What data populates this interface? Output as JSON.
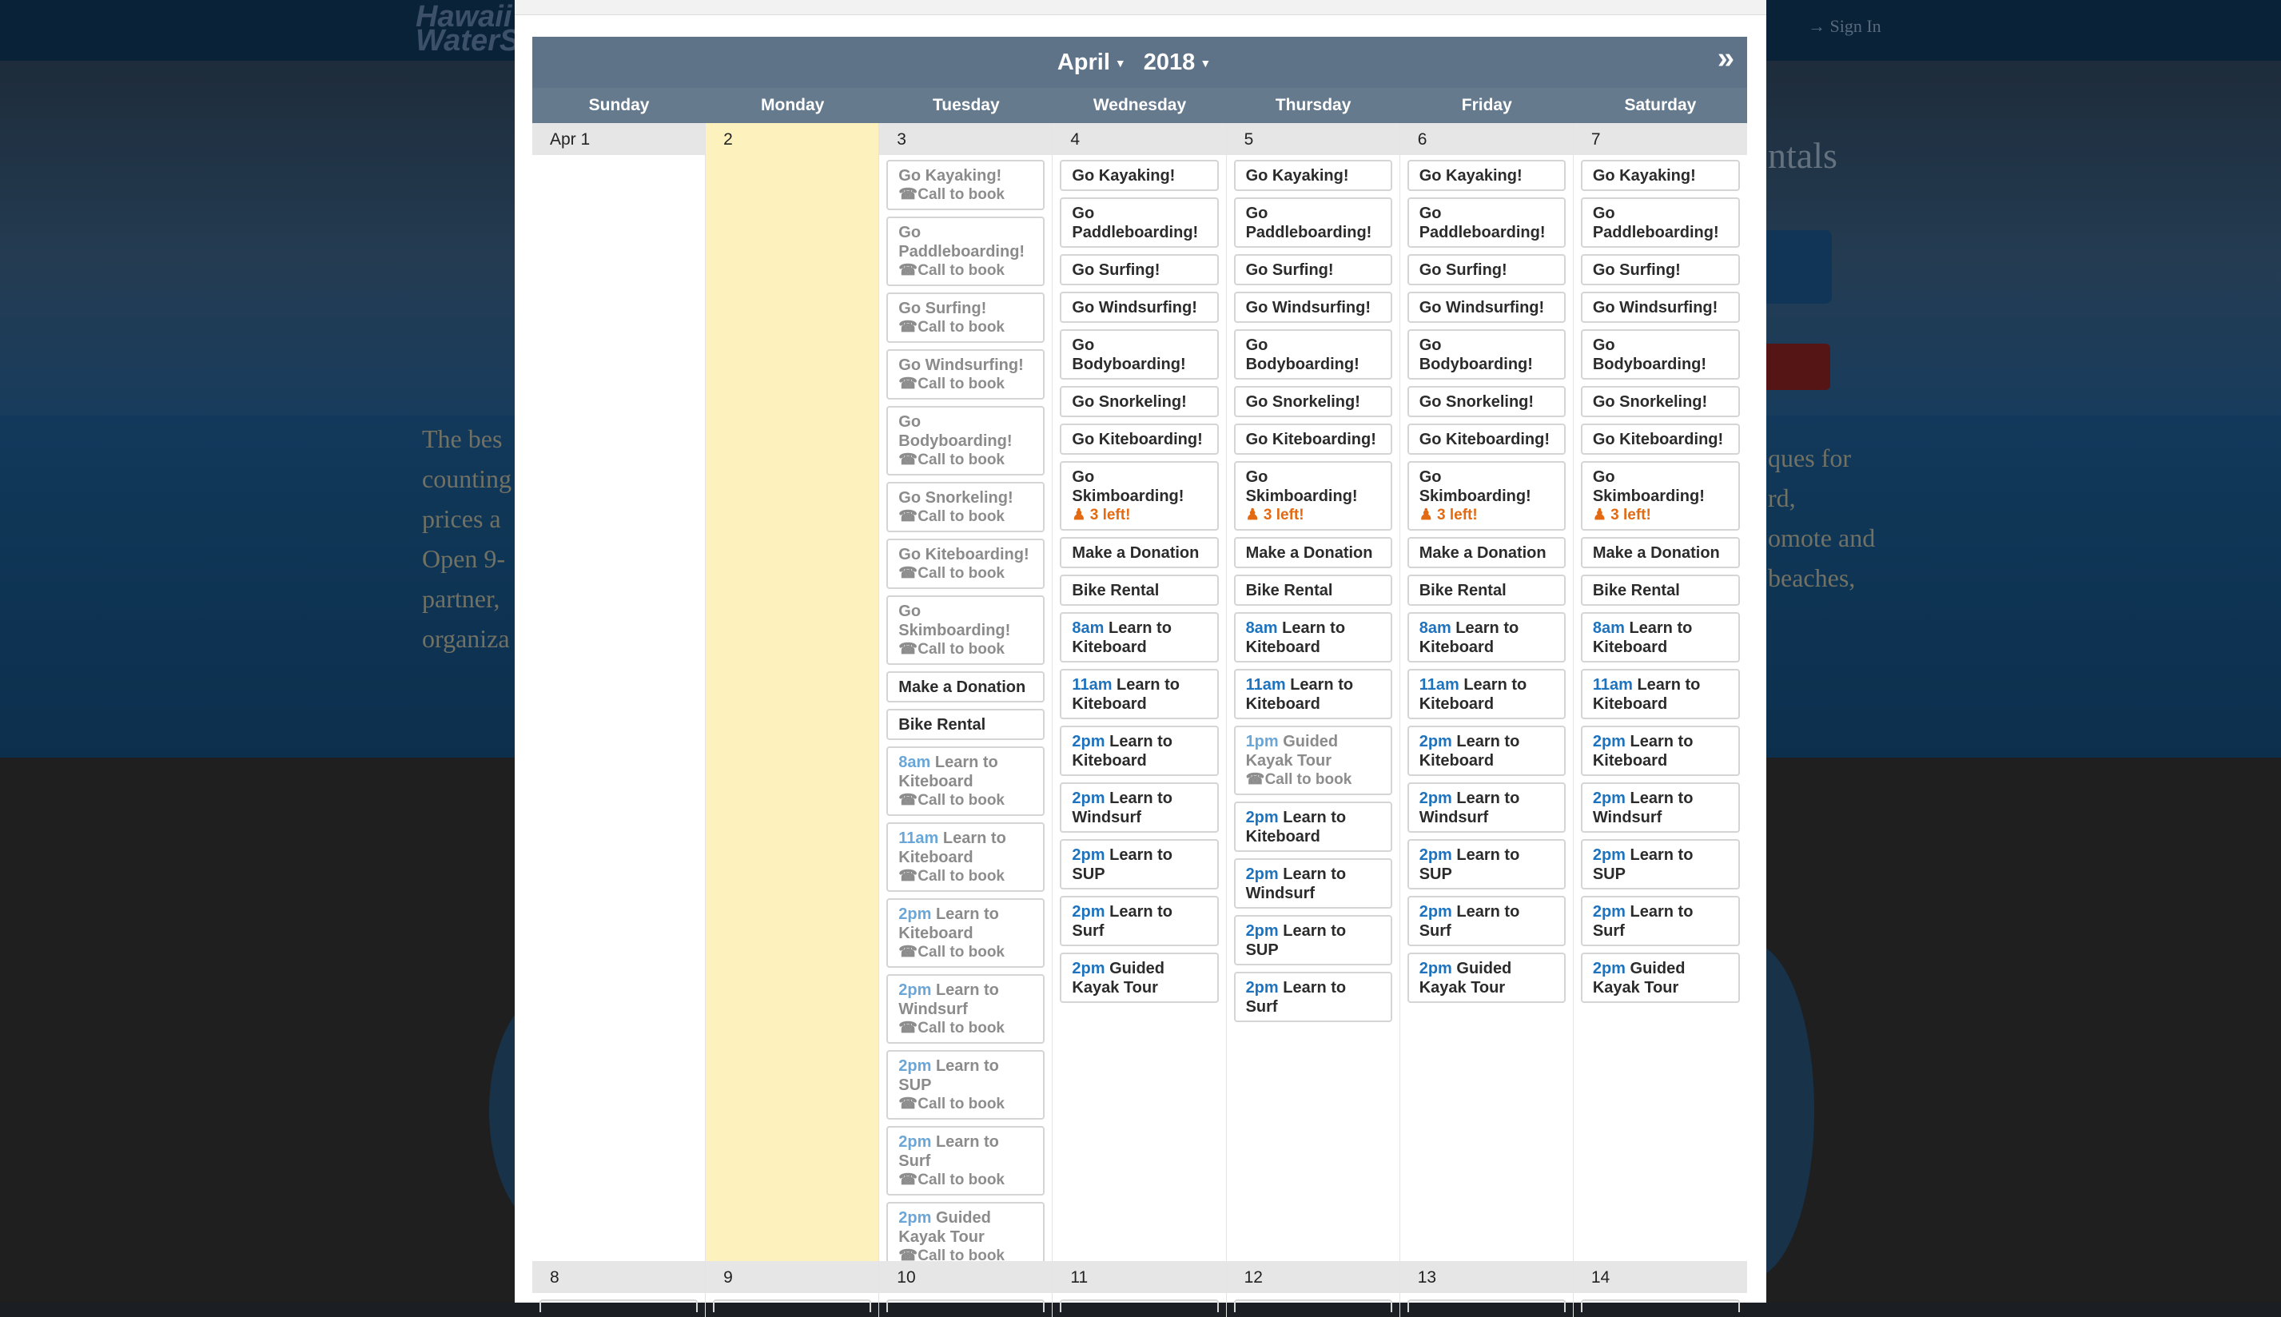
{
  "background": {
    "brand_line1": "Hawaii",
    "brand_line2": "WaterSports",
    "signin": "Sign In",
    "hero_left_lines": [
      "The bes",
      "counting",
      "prices a",
      "Open 9-",
      "partner,",
      "organiza"
    ],
    "hero_right_lines": [
      "ques for",
      "",
      "rd,",
      "omote and",
      "beaches,"
    ],
    "rentals_heading": "ntals"
  },
  "calendar": {
    "month": "April",
    "year": "2018",
    "next_label": "»",
    "days_of_week": [
      "Sunday",
      "Monday",
      "Tuesday",
      "Wednesday",
      "Thursday",
      "Friday",
      "Saturday"
    ],
    "week1": [
      {
        "label": "Apr 1",
        "events": []
      },
      {
        "label": "2",
        "events": []
      },
      {
        "label": "3",
        "events": [
          {
            "time": "",
            "title": "Go Kayaking!",
            "sub": "Call to book"
          },
          {
            "time": "",
            "title": "Go Paddleboarding!",
            "sub": "Call to book"
          },
          {
            "time": "",
            "title": "Go Surfing!",
            "sub": "Call to book"
          },
          {
            "time": "",
            "title": "Go Windsurfing!",
            "sub": "Call to book"
          },
          {
            "time": "",
            "title": "Go Bodyboarding!",
            "sub": "Call to book"
          },
          {
            "time": "",
            "title": "Go Snorkeling!",
            "sub": "Call to book"
          },
          {
            "time": "",
            "title": "Go Kiteboarding!",
            "sub": "Call to book"
          },
          {
            "time": "",
            "title": "Go Skimboarding!",
            "sub": "Call to book"
          },
          {
            "time": "",
            "title": "Make a Donation",
            "active": true
          },
          {
            "time": "",
            "title": "Bike Rental",
            "active": true
          },
          {
            "time": "8am",
            "title": "Learn to Kiteboard",
            "sub": "Call to book"
          },
          {
            "time": "11am",
            "title": "Learn to Kiteboard",
            "sub": "Call to book"
          },
          {
            "time": "2pm",
            "title": "Learn to Kiteboard",
            "sub": "Call to book"
          },
          {
            "time": "2pm",
            "title": "Learn to Windsurf",
            "sub": "Call to book"
          },
          {
            "time": "2pm",
            "title": "Learn to SUP",
            "sub": "Call to book"
          },
          {
            "time": "2pm",
            "title": "Learn to Surf",
            "sub": "Call to book"
          },
          {
            "time": "2pm",
            "title": "Guided Kayak Tour",
            "sub": "Call to book"
          }
        ]
      },
      {
        "label": "4",
        "events": [
          {
            "time": "",
            "title": "Go Kayaking!"
          },
          {
            "time": "",
            "title": "Go Paddleboarding!"
          },
          {
            "time": "",
            "title": "Go Surfing!"
          },
          {
            "time": "",
            "title": "Go Windsurfing!"
          },
          {
            "time": "",
            "title": "Go Bodyboarding!"
          },
          {
            "time": "",
            "title": "Go Snorkeling!"
          },
          {
            "time": "",
            "title": "Go Kiteboarding!"
          },
          {
            "time": "",
            "title": "Go Skimboarding!",
            "left": "3 left!"
          },
          {
            "time": "",
            "title": "Make a Donation"
          },
          {
            "time": "",
            "title": "Bike Rental"
          },
          {
            "time": "8am",
            "title": "Learn to Kiteboard"
          },
          {
            "time": "11am",
            "title": "Learn to Kiteboard"
          },
          {
            "time": "2pm",
            "title": "Learn to Kiteboard"
          },
          {
            "time": "2pm",
            "title": "Learn to Windsurf"
          },
          {
            "time": "2pm",
            "title": "Learn to SUP"
          },
          {
            "time": "2pm",
            "title": "Learn to Surf"
          },
          {
            "time": "2pm",
            "title": "Guided Kayak Tour"
          }
        ]
      },
      {
        "label": "5",
        "events": [
          {
            "time": "",
            "title": "Go Kayaking!"
          },
          {
            "time": "",
            "title": "Go Paddleboarding!"
          },
          {
            "time": "",
            "title": "Go Surfing!"
          },
          {
            "time": "",
            "title": "Go Windsurfing!"
          },
          {
            "time": "",
            "title": "Go Bodyboarding!"
          },
          {
            "time": "",
            "title": "Go Snorkeling!"
          },
          {
            "time": "",
            "title": "Go Kiteboarding!"
          },
          {
            "time": "",
            "title": "Go Skimboarding!",
            "left": "3 left!"
          },
          {
            "time": "",
            "title": "Make a Donation"
          },
          {
            "time": "",
            "title": "Bike Rental"
          },
          {
            "time": "8am",
            "title": "Learn to Kiteboard"
          },
          {
            "time": "11am",
            "title": "Learn to Kiteboard"
          },
          {
            "time": "1pm",
            "title": "Guided Kayak Tour",
            "sub": "Call to book",
            "past": true
          },
          {
            "time": "2pm",
            "title": "Learn to Kiteboard"
          },
          {
            "time": "2pm",
            "title": "Learn to Windsurf"
          },
          {
            "time": "2pm",
            "title": "Learn to SUP"
          },
          {
            "time": "2pm",
            "title": "Learn to Surf"
          }
        ]
      },
      {
        "label": "6",
        "events": [
          {
            "time": "",
            "title": "Go Kayaking!"
          },
          {
            "time": "",
            "title": "Go Paddleboarding!"
          },
          {
            "time": "",
            "title": "Go Surfing!"
          },
          {
            "time": "",
            "title": "Go Windsurfing!"
          },
          {
            "time": "",
            "title": "Go Bodyboarding!"
          },
          {
            "time": "",
            "title": "Go Snorkeling!"
          },
          {
            "time": "",
            "title": "Go Kiteboarding!"
          },
          {
            "time": "",
            "title": "Go Skimboarding!",
            "left": "3 left!"
          },
          {
            "time": "",
            "title": "Make a Donation"
          },
          {
            "time": "",
            "title": "Bike Rental"
          },
          {
            "time": "8am",
            "title": "Learn to Kiteboard"
          },
          {
            "time": "11am",
            "title": "Learn to Kiteboard"
          },
          {
            "time": "2pm",
            "title": "Learn to Kiteboard"
          },
          {
            "time": "2pm",
            "title": "Learn to Windsurf"
          },
          {
            "time": "2pm",
            "title": "Learn to SUP"
          },
          {
            "time": "2pm",
            "title": "Learn to Surf"
          },
          {
            "time": "2pm",
            "title": "Guided Kayak Tour"
          }
        ]
      },
      {
        "label": "7",
        "events": [
          {
            "time": "",
            "title": "Go Kayaking!"
          },
          {
            "time": "",
            "title": "Go Paddleboarding!"
          },
          {
            "time": "",
            "title": "Go Surfing!"
          },
          {
            "time": "",
            "title": "Go Windsurfing!"
          },
          {
            "time": "",
            "title": "Go Bodyboarding!"
          },
          {
            "time": "",
            "title": "Go Snorkeling!"
          },
          {
            "time": "",
            "title": "Go Kiteboarding!"
          },
          {
            "time": "",
            "title": "Go Skimboarding!",
            "left": "3 left!"
          },
          {
            "time": "",
            "title": "Make a Donation"
          },
          {
            "time": "",
            "title": "Bike Rental"
          },
          {
            "time": "8am",
            "title": "Learn to Kiteboard"
          },
          {
            "time": "11am",
            "title": "Learn to Kiteboard"
          },
          {
            "time": "2pm",
            "title": "Learn to Kiteboard"
          },
          {
            "time": "2pm",
            "title": "Learn to Windsurf"
          },
          {
            "time": "2pm",
            "title": "Learn to SUP"
          },
          {
            "time": "2pm",
            "title": "Learn to Surf"
          },
          {
            "time": "2pm",
            "title": "Guided Kayak Tour"
          }
        ]
      }
    ],
    "week2_labels": [
      "8",
      "9",
      "10",
      "11",
      "12",
      "13",
      "14"
    ]
  },
  "icons": {
    "phone": "phone-icon",
    "person": "person-icon",
    "signin": "signin-icon"
  },
  "colors": {
    "header": "#5f7388",
    "today": "#fdf1bd",
    "time": "#1e73be",
    "spots_left": "#e36a12"
  }
}
